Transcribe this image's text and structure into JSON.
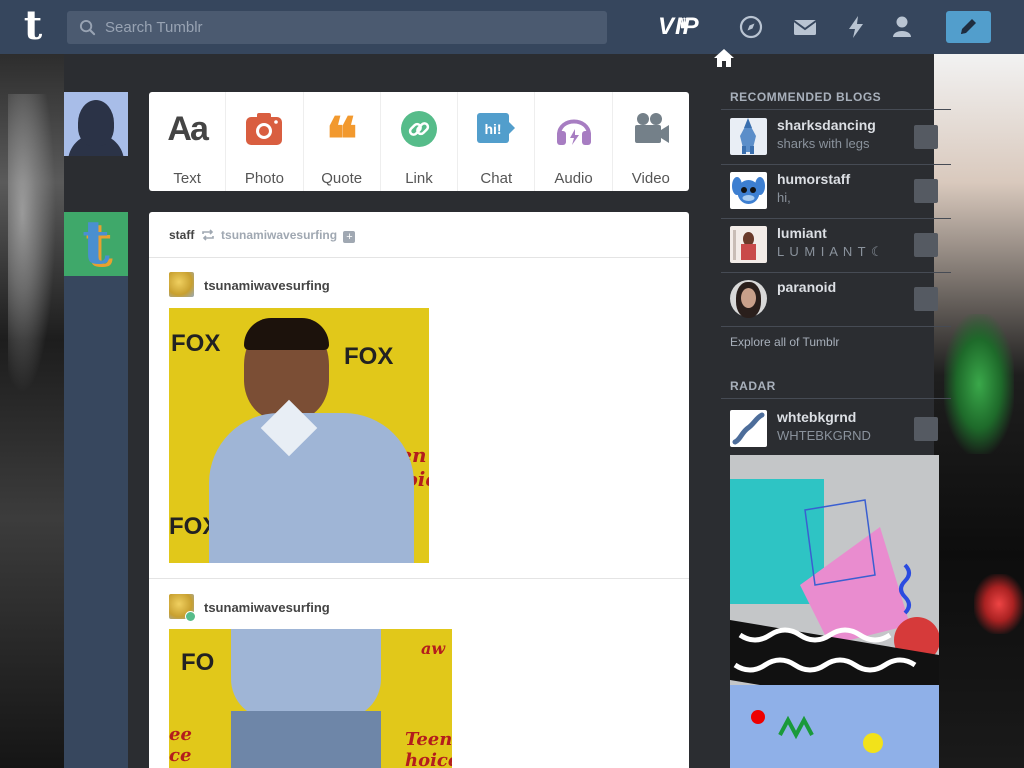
{
  "header": {
    "search_placeholder": "Search Tumblr",
    "vip_label": "VIP",
    "accent": "#36465d",
    "compose_color": "#529ecc",
    "nav_icons": [
      "explore-icon",
      "inbox-icon",
      "activity-icon",
      "account-icon",
      "compose-icon"
    ]
  },
  "post_types": [
    {
      "label": "Text",
      "icon": "text-icon",
      "color": "#444444"
    },
    {
      "label": "Photo",
      "icon": "camera-icon",
      "color": "#d95e40"
    },
    {
      "label": "Quote",
      "icon": "quote-icon",
      "color": "#f2992e"
    },
    {
      "label": "Link",
      "icon": "link-icon",
      "color": "#56bc8a"
    },
    {
      "label": "Chat",
      "icon": "chat-icon",
      "color": "#529ecc"
    },
    {
      "label": "Audio",
      "icon": "headphones-icon",
      "color": "#a77dc2"
    },
    {
      "label": "Video",
      "icon": "video-camera-icon",
      "color": "#748089"
    }
  ],
  "feed": {
    "reblogger": "staff",
    "source": "tsunamiwavesurfing",
    "posts": [
      {
        "author": "tsunamiwavesurfing"
      },
      {
        "author": "tsunamiwavesurfing"
      }
    ]
  },
  "sidebar": {
    "recommended_title": "RECOMMENDED BLOGS",
    "blogs": [
      {
        "name": "sharksdancing",
        "subtitle": "sharks with legs"
      },
      {
        "name": "humorstaff",
        "subtitle": "hi,"
      },
      {
        "name": "lumiant",
        "subtitle": "L U M I A N T ☾"
      },
      {
        "name": "paranoid",
        "subtitle": ""
      }
    ],
    "explore_label": "Explore all of Tumblr",
    "radar_title": "RADAR",
    "radar": {
      "name": "whtebkgrnd",
      "subtitle": "WHTEBKGRND"
    }
  }
}
